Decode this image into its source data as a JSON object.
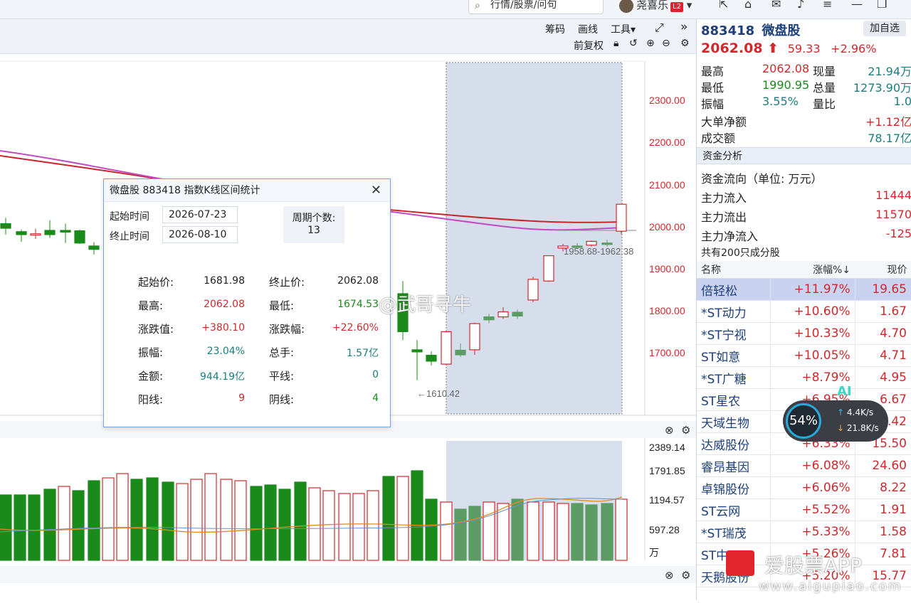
{
  "topbar": {
    "search_placeholder": "行情/股票/问句",
    "username": "尧喜乐",
    "level_badge": "L2"
  },
  "toolbar": {
    "items": [
      "筹码",
      "画线",
      "工具▾"
    ],
    "rights": "前复权",
    "icons": [
      "expand-icon",
      "collapse-icon",
      "lock-icon",
      "undo-icon",
      "zoom-in-icon",
      "zoom-out-icon",
      "gear-icon"
    ]
  },
  "price_axis": [
    "2300.00",
    "2200.00",
    "2100.00",
    "2000.00",
    "1900.00",
    "1800.00",
    "1700.00"
  ],
  "volume_axis": [
    "2389.14",
    "1791.85",
    "1194.57",
    "597.28",
    "万"
  ],
  "range_annotation": "1958.68-1962.38",
  "low_annotation": "←1610.42",
  "dialog": {
    "title": "微盘股  883418  指数K线区间统计",
    "start_label": "起始时间",
    "start_value": "2026-07-23",
    "end_label": "终止时间",
    "end_value": "2026-08-10",
    "period_label": "周期个数:",
    "period_value": "13",
    "stats": [
      {
        "label": "起始价:",
        "value": "1681.98",
        "color": "#222"
      },
      {
        "label": "终止价:",
        "value": "2062.08",
        "color": "#222"
      },
      {
        "label": "最高:",
        "value": "2062.08",
        "color": "#d0282d"
      },
      {
        "label": "最低:",
        "value": "1674.53",
        "color": "#1a8a1a"
      },
      {
        "label": "涨跌值:",
        "value": "+380.10",
        "color": "#d0282d"
      },
      {
        "label": "涨跌幅:",
        "value": "+22.60%",
        "color": "#d0282d"
      },
      {
        "label": "振幅:",
        "value": "23.04%",
        "color": "#1b7e7e"
      },
      {
        "label": "总手:",
        "value": "1.57亿",
        "color": "#1b7e7e"
      },
      {
        "label": "金额:",
        "value": "944.19亿",
        "color": "#1b7e7e"
      },
      {
        "label": "平线:",
        "value": "0",
        "color": "#1b7e7e"
      },
      {
        "label": "阳线:",
        "value": "9",
        "color": "#d0282d"
      },
      {
        "label": "阴线:",
        "value": "4",
        "color": "#1a8a1a"
      }
    ]
  },
  "quote": {
    "code": "883418",
    "name": "微盘股",
    "add_button": "加自选",
    "price": "2062.08",
    "arrow": "⬆",
    "change": "59.33",
    "change_pct": "+2.96%",
    "rows": [
      {
        "l1": "最高",
        "v1": "2062.08",
        "l2": "现量",
        "v2": "21.94万"
      },
      {
        "l1": "最低",
        "v1": "1990.95",
        "l2": "总量",
        "v2": "1273.90万"
      },
      {
        "l1": "振幅",
        "v1": "3.55%",
        "l2": "量比",
        "v2": "1.0"
      }
    ],
    "big_net_label": "大单净额",
    "big_net_value": "+1.12亿",
    "turnover_label": "成交额",
    "turnover_value": "78.17亿"
  },
  "fund": {
    "section": "资金分析",
    "unit": "资金流向（单位: 万元）",
    "rows": [
      {
        "label": "主力流入",
        "value": "11444"
      },
      {
        "label": "主力流出",
        "value": "11570"
      },
      {
        "label": "主力净流入",
        "value": "-125"
      }
    ]
  },
  "constituents": {
    "section": "共有200只成分股",
    "headers": [
      "名称",
      "涨幅%↓",
      "现价"
    ],
    "rows": [
      {
        "name": "倍轻松",
        "chg": "+11.97%",
        "price": "19.65"
      },
      {
        "name": "*ST动力",
        "chg": "+10.60%",
        "price": "1.67"
      },
      {
        "name": "*ST宁视",
        "chg": "+10.33%",
        "price": "4.70"
      },
      {
        "name": "ST如意",
        "chg": "+10.05%",
        "price": "4.71"
      },
      {
        "name": "*ST广糖",
        "chg": "+8.79%",
        "price": "4.95"
      },
      {
        "name": "ST星农",
        "chg": "+6.95%",
        "price": "6.67"
      },
      {
        "name": "天域生物",
        "chg": "+6.62%",
        "price": "6.42"
      },
      {
        "name": "达威股份",
        "chg": "+6.33%",
        "price": "15.50"
      },
      {
        "name": "睿昂基因",
        "chg": "+6.08%",
        "price": "24.60"
      },
      {
        "name": "卓锦股份",
        "chg": "+6.06%",
        "price": "8.22"
      },
      {
        "name": "ST云网",
        "chg": "+5.52%",
        "price": "1.91"
      },
      {
        "name": "*ST瑞茂",
        "chg": "+5.33%",
        "price": "1.58"
      },
      {
        "name": "ST中",
        "chg": "+5.26%",
        "price": "7.81"
      },
      {
        "name": "天鹅股份",
        "chg": "+5.20%",
        "price": "15.77"
      }
    ]
  },
  "speed": {
    "percent": "54%",
    "up": "4.4K/s",
    "down": "21.8K/s",
    "ai": "AI"
  },
  "watermarks": {
    "weibo": "@武哥寻牛",
    "app": "爱股票APP",
    "url": "www.aigupiao.com"
  },
  "colors": {
    "up": "#d0282d",
    "down": "#1a8a1a",
    "highlight": "#c9d3e6"
  }
}
